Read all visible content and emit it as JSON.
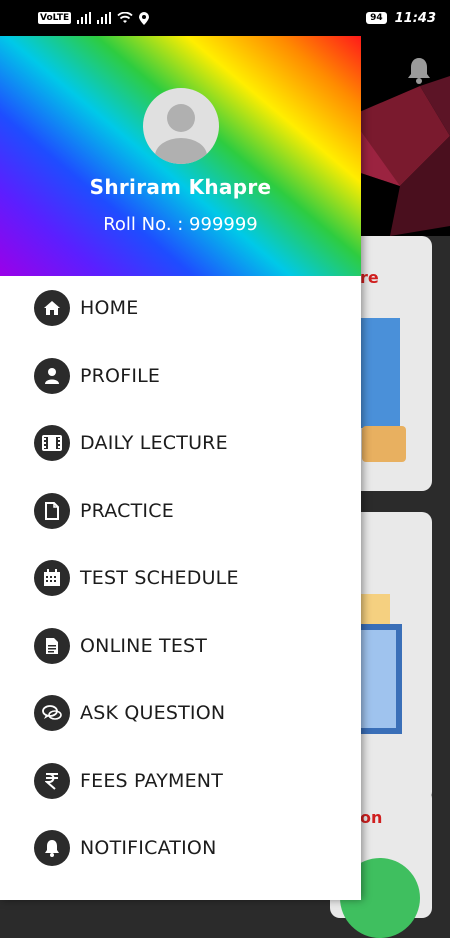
{
  "status_bar": {
    "network_badge": "VoLTE",
    "battery": "94",
    "time": "11:43"
  },
  "drawer": {
    "user_name": "Shriram Khapre",
    "roll_no": "Roll No. : 999999",
    "items": [
      {
        "label": "HOME",
        "icon": "home-icon"
      },
      {
        "label": "PROFILE",
        "icon": "person-icon"
      },
      {
        "label": "DAILY LECTURE",
        "icon": "film-icon"
      },
      {
        "label": "PRACTICE",
        "icon": "document-icon"
      },
      {
        "label": "TEST SCHEDULE",
        "icon": "calendar-icon"
      },
      {
        "label": "ONLINE TEST",
        "icon": "file-text-icon"
      },
      {
        "label": "ASK QUESTION",
        "icon": "chat-bubbles-icon"
      },
      {
        "label": "FEES PAYMENT",
        "icon": "rupee-icon"
      },
      {
        "label": "NOTIFICATION",
        "icon": "bell-icon"
      }
    ]
  },
  "background": {
    "card1_fragment": "re",
    "card3_fragment": "on"
  },
  "colors": {
    "accent_red": "#d01f1f",
    "icon_circle": "#2b2b2b"
  }
}
